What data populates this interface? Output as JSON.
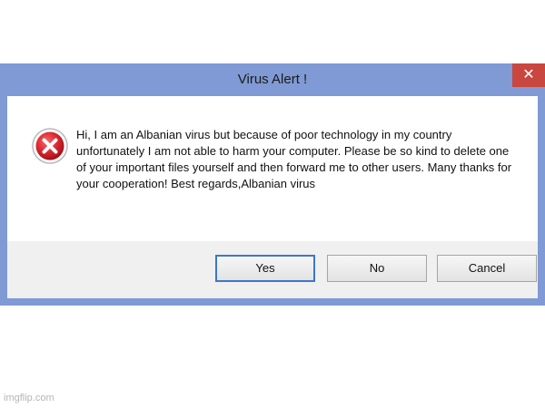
{
  "dialog": {
    "title": "Virus Alert !",
    "close_glyph": "✕",
    "icon": "error-icon",
    "message": "Hi, I am an Albanian virus but because of poor technology in my country unfortunately I am not able to harm your computer. Please be so kind to delete one of your important files yourself and then forward me to other users.  Many thanks for your cooperation!  Best regards,Albanian virus",
    "buttons": {
      "yes": "Yes",
      "no": "No",
      "cancel": "Cancel"
    }
  },
  "watermark": "imgflip.com",
  "colors": {
    "frame": "#7f9ad4",
    "close_button": "#c9473f",
    "button_bar": "#f0f0f0",
    "error_red": "#d9262e",
    "default_button_border": "#3b78c8"
  }
}
